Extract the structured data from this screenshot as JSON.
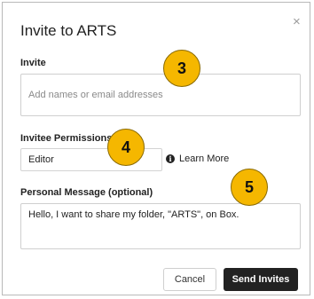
{
  "dialog": {
    "title": "Invite to ARTS",
    "close_symbol": "×"
  },
  "invite": {
    "label": "Invite",
    "placeholder": "Add names or email addresses",
    "value": ""
  },
  "permissions": {
    "label": "Invitee Permissions",
    "selected": "Editor",
    "learn_more_icon": "info-icon",
    "learn_more_label": "Learn More"
  },
  "message": {
    "label": "Personal Message (optional)",
    "value": "Hello, I want to share my folder, \"ARTS\", on Box."
  },
  "actions": {
    "cancel_label": "Cancel",
    "send_label": "Send Invites"
  },
  "annotations": [
    {
      "number": "3",
      "color": "#f5b700"
    },
    {
      "number": "4",
      "color": "#f5b700"
    },
    {
      "number": "5",
      "color": "#f5b700"
    }
  ]
}
